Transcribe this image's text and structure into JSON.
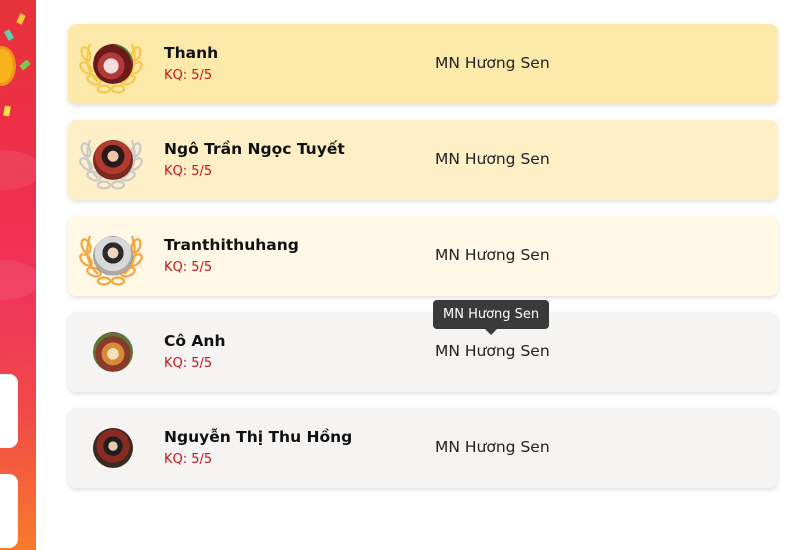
{
  "leaderboard": {
    "entries": [
      {
        "name": "Thanh",
        "score": "KQ: 5/5",
        "school": "MN Hương Sen",
        "medal": "gold"
      },
      {
        "name": "Ngô Trần Ngọc Tuyết",
        "score": "KQ: 5/5",
        "school": "MN Hương Sen",
        "medal": "silver"
      },
      {
        "name": "Tranthithuhang",
        "score": "KQ: 5/5",
        "school": "MN Hương Sen",
        "medal": "bronze"
      },
      {
        "name": "Cô Anh",
        "score": "KQ: 5/5",
        "school": "MN Hương Sen",
        "medal": ""
      },
      {
        "name": "Nguyễn Thị Thu Hồng",
        "score": "KQ: 5/5",
        "school": "MN Hương Sen",
        "medal": ""
      }
    ]
  },
  "tooltip": {
    "text": "MN Hương Sen"
  },
  "colors": {
    "gold_row": "#fde9a9",
    "silver_row": "#feefc7",
    "bronze_row": "#fff8e6",
    "plain_row": "#f6f4f2",
    "gold_laurel": "#f5c84a",
    "silver_laurel": "#c9c9c9",
    "bronze_laurel": "#f5a53a",
    "score_text": "#c4161c",
    "tooltip_bg": "#3a3a3a"
  },
  "icons": {
    "laurel": "laurel-wreath-icon"
  }
}
